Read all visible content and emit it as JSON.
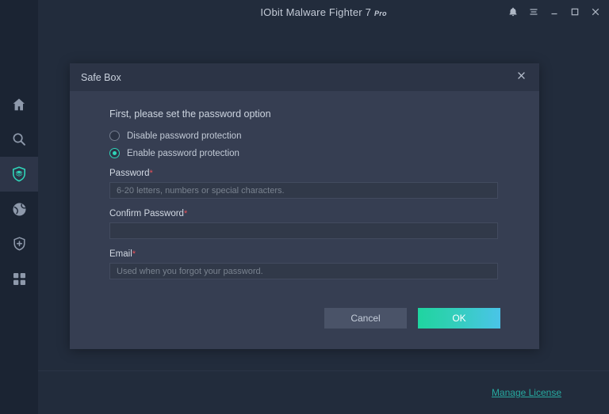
{
  "window": {
    "title": "IObit Malware Fighter 7",
    "title_suffix": "Pro",
    "controls": [
      {
        "name": "notifications-icon",
        "label": "Notifications"
      },
      {
        "name": "menu-icon",
        "label": "Menu"
      },
      {
        "name": "minimize-icon",
        "label": "Minimize"
      },
      {
        "name": "maximize-icon",
        "label": "Maximize"
      },
      {
        "name": "close-icon",
        "label": "Close"
      }
    ]
  },
  "sidebar": {
    "items": [
      {
        "icon": "home-icon",
        "label": "Home",
        "active": false
      },
      {
        "icon": "search-icon",
        "label": "Scan",
        "active": false
      },
      {
        "icon": "shield-layers-icon",
        "label": "Protect",
        "active": true
      },
      {
        "icon": "globe-icon",
        "label": "Browser Protect",
        "active": false
      },
      {
        "icon": "shield-plus-icon",
        "label": "Action Center",
        "active": false
      },
      {
        "icon": "grid-icon",
        "label": "Toolbox",
        "active": false
      }
    ]
  },
  "footer": {
    "manage_license": "Manage License"
  },
  "dialog": {
    "title": "Safe Box",
    "close_icon": "close-icon",
    "intro": "First, please set the password option",
    "radios": [
      {
        "label": "Disable password protection",
        "checked": false
      },
      {
        "label": "Enable password protection",
        "checked": true
      }
    ],
    "fields": [
      {
        "label": "Password",
        "required_marker": "*",
        "value": "",
        "placeholder": "6-20 letters, numbers or special characters."
      },
      {
        "label": "Confirm Password",
        "required_marker": "*",
        "value": "",
        "placeholder": ""
      },
      {
        "label": "Email",
        "required_marker": "*",
        "value": "",
        "placeholder": "Used when you forgot your password."
      }
    ],
    "buttons": {
      "cancel": "Cancel",
      "ok": "OK"
    }
  },
  "colors": {
    "accent_teal": "#2fd5b9",
    "accent_cyan": "#4ac4e8",
    "link_teal": "#27a9a0",
    "required_red": "#e8515a",
    "window_bg": "#222c3c",
    "sidebar_bg": "#1b2433",
    "dialog_bg": "#363e52",
    "dialog_header_bg": "#2c3446"
  }
}
